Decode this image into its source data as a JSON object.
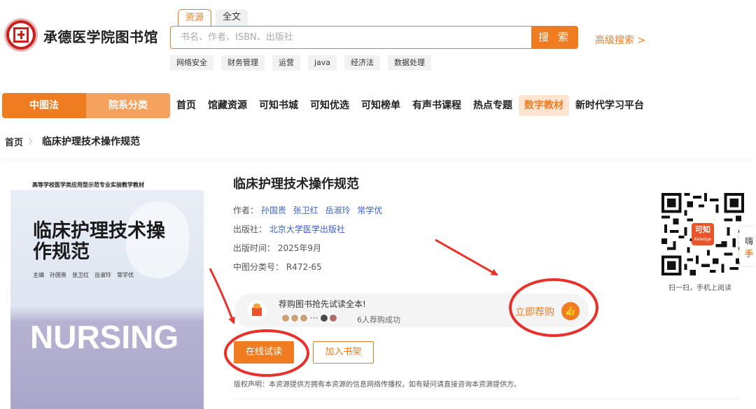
{
  "header": {
    "library_name": "承德医学院图书馆",
    "search_tabs": [
      "资源",
      "全文"
    ],
    "search_placeholder": "书名、作者、ISBN、出版社",
    "search_button": "搜 索",
    "advanced_search": "高级搜索 >",
    "hot_tags": [
      "网络安全",
      "财务管理",
      "运营",
      "java",
      "经济法",
      "数据处理"
    ]
  },
  "nav": {
    "left_tabs": [
      "中图法",
      "院系分类"
    ],
    "items": [
      "首页",
      "馆藏资源",
      "可知书城",
      "可知优选",
      "可知榜单",
      "有声书课程",
      "热点专题",
      "数字教材",
      "新时代学习平台"
    ],
    "highlighted": "数字教材"
  },
  "breadcrumb": {
    "home": "首页",
    "current": "临床护理技术操作规范"
  },
  "cover": {
    "series": "高等学校医学类应用型示范专业实验教学教材",
    "title": "临床护理技术操作规范",
    "authors": "主编　孙国贵　张卫红　岳淑玲　常学优",
    "nursing": "NURSING"
  },
  "book": {
    "title": "临床护理技术操作规范",
    "author_label": "作者：",
    "authors": [
      "孙国贵",
      "张卫红",
      "岳淑玲",
      "常学优"
    ],
    "publisher_label": "出版社：",
    "publisher": "北京大学医学出版社",
    "date_label": "出版时间：",
    "date": "2025年9月",
    "class_label": "中图分类号：",
    "class_no": "R472-65"
  },
  "buy_bar": {
    "text": "荐购图书抢先试读全本!",
    "dots": "···",
    "count": "6人荐购成功",
    "action": "立即荐购",
    "thumb_icon": "thumbs-up-icon"
  },
  "actions": {
    "read_online": "在线试读",
    "add_shelf": "加入书架"
  },
  "copyright": "版权声明：本资源提供方拥有本资源的信息网络传播权，如有疑问请直接咨询本资源提供方。",
  "qr": {
    "badge": "可知",
    "badge_sub": "Keledge",
    "caption": "扫一扫，手机上阅读"
  },
  "side_tab": {
    "line1": "嗨",
    "line2": "手"
  },
  "colors": {
    "accent": "#f07c22",
    "accent_light": "#f5a25f",
    "annotation_red": "#e8312a",
    "link_blue": "#3a5ec8"
  }
}
